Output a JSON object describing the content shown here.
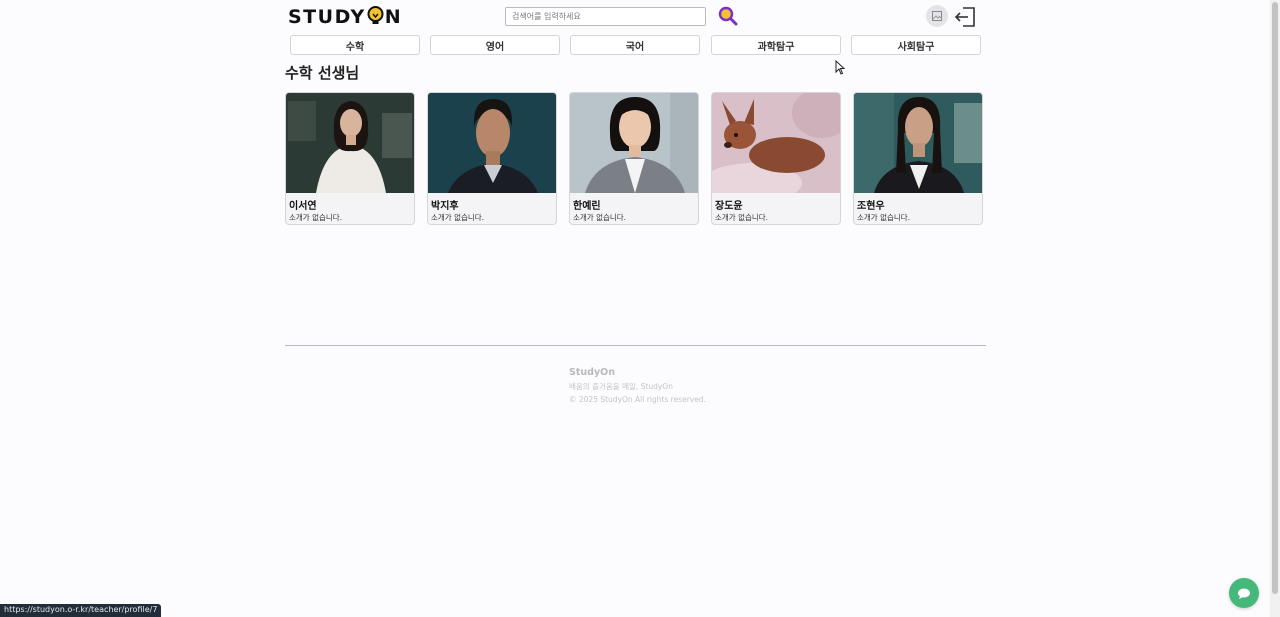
{
  "header": {
    "logo_left": "STUDY ",
    "logo_right": "N",
    "search_placeholder": "검색어를 입력하세요",
    "search_icon": "magnifier-icon",
    "avatar_icon": "image-icon",
    "logout_icon": "logout-icon"
  },
  "tabs": [
    {
      "label": "수학"
    },
    {
      "label": "영어"
    },
    {
      "label": "국어"
    },
    {
      "label": "과학탐구"
    },
    {
      "label": "사회탐구"
    }
  ],
  "section_title": "수학 선생님",
  "teachers": [
    {
      "name": "이서연",
      "desc": "소개가 없습니다."
    },
    {
      "name": "박지후",
      "desc": "소개가 없습니다."
    },
    {
      "name": "한예린",
      "desc": "소개가 없습니다."
    },
    {
      "name": "장도윤",
      "desc": "소개가 없습니다."
    },
    {
      "name": "조현우",
      "desc": "소개가 없습니다."
    }
  ],
  "footer": {
    "brand": "StudyOn",
    "tagline": "배움의 즐거움을 매일, StudyOn",
    "copyright": "© 2025 StudyOn All rights reserved."
  },
  "status_url": "https://studyon.o-r.kr/teacher/profile/7",
  "colors": {
    "accent_purple": "#7b2fc9",
    "bulb_yellow": "#f2c230",
    "chat_green": "#45b97a"
  }
}
